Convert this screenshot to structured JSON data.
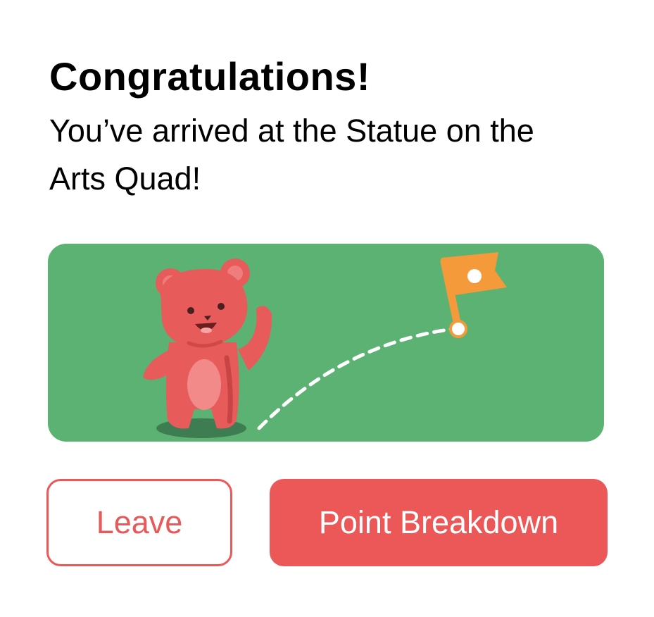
{
  "header": {
    "title": "Congratulations!",
    "message": "You’ve arrived at the Statue on the Arts Quad!"
  },
  "illustration": {
    "icons": [
      "bear-mascot-icon",
      "flag-icon"
    ],
    "background_color": "#5bb272"
  },
  "actions": {
    "leave_label": "Leave",
    "point_breakdown_label": "Point Breakdown"
  },
  "colors": {
    "accent": "#ec5757",
    "leave_text": "#e55b5b",
    "button_text_on_accent": "#ffffff",
    "flag": "#f59a3b"
  }
}
